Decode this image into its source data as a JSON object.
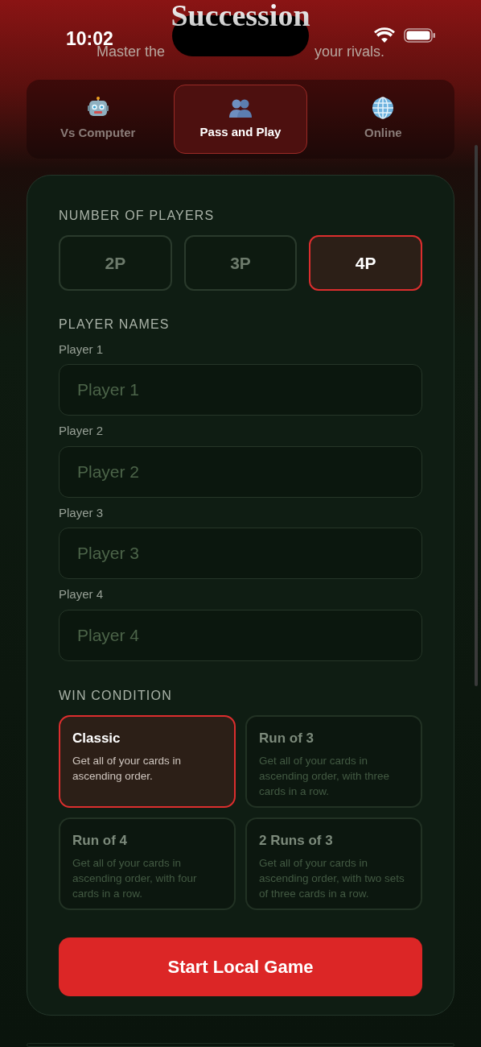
{
  "status_bar": {
    "time": "10:02"
  },
  "header": {
    "title": "Succession",
    "subtitle_parts": [
      "Master the",
      "your rivals."
    ]
  },
  "mode_tabs": [
    {
      "label": "Vs Computer",
      "kind": "robot",
      "selected": false
    },
    {
      "label": "Pass and Play",
      "kind": "people",
      "selected": true
    },
    {
      "label": "Online",
      "kind": "globe",
      "selected": false
    }
  ],
  "players": {
    "label": "NUMBER OF PLAYERS",
    "options": [
      {
        "label": "2P",
        "selected": false
      },
      {
        "label": "3P",
        "selected": false
      },
      {
        "label": "4P",
        "selected": true
      }
    ]
  },
  "player_names": {
    "label": "PLAYER NAMES",
    "fields": [
      {
        "label": "Player 1",
        "placeholder": "Player 1"
      },
      {
        "label": "Player 2",
        "placeholder": "Player 2"
      },
      {
        "label": "Player 3",
        "placeholder": "Player 3"
      },
      {
        "label": "Player 4",
        "placeholder": "Player 4"
      }
    ]
  },
  "win_condition": {
    "label": "WIN CONDITION",
    "options": [
      {
        "title": "Classic",
        "description": "Get all of your cards in ascending order.",
        "selected": true
      },
      {
        "title": "Run of 3",
        "description": "Get all of your cards in ascending order, with three cards in a row.",
        "selected": false
      },
      {
        "title": "Run of 4",
        "description": "Get all of your cards in ascending order, with four cards in a row.",
        "selected": false
      },
      {
        "title": "2 Runs of 3",
        "description": "Get all of your cards in ascending order, with two sets of three cards in a row.",
        "selected": false
      }
    ]
  },
  "start_button": "Start Local Game"
}
